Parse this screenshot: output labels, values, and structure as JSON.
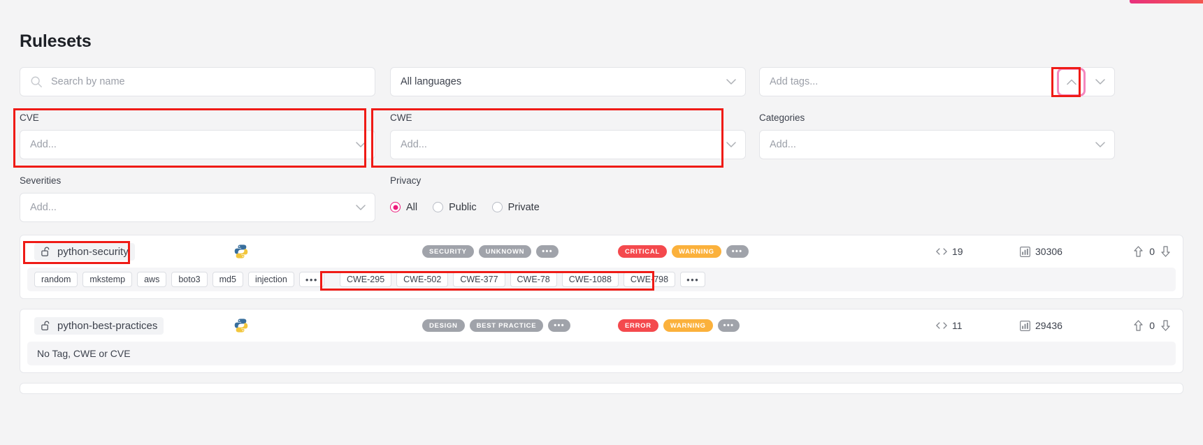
{
  "page": {
    "title": "Rulesets"
  },
  "filters": {
    "search": {
      "name": "Search by name",
      "placeholder": "Search by name",
      "value": ""
    },
    "language": {
      "label": "",
      "value": "All languages"
    },
    "tags": {
      "label": "",
      "placeholder": "Add tags..."
    },
    "cve": {
      "label": "CVE",
      "placeholder": "Add..."
    },
    "cwe": {
      "label": "CWE",
      "placeholder": "Add..."
    },
    "categories": {
      "label": "Categories",
      "placeholder": "Add..."
    },
    "severities": {
      "label": "Severities",
      "placeholder": "Add..."
    },
    "privacy": {
      "label": "Privacy",
      "options": [
        {
          "label": "All",
          "selected": true
        },
        {
          "label": "Public",
          "selected": false
        },
        {
          "label": "Private",
          "selected": false
        }
      ]
    },
    "collapse_button": {
      "icon": "chevron-up-icon"
    }
  },
  "colors": {
    "accent_pink": "#ec1a7c",
    "annotation_red": "#ef1b16",
    "highlight_pink": "#f487bd",
    "critical": "#f4494d",
    "warning": "#fbb13c",
    "grey_badge": "#a0a3aa"
  },
  "rulesets": [
    {
      "name": "python-security",
      "lock_icon": "unlock-icon",
      "language": "python",
      "categories": [
        "SECURITY",
        "UNKNOWN"
      ],
      "categories_more": "•••",
      "severities": [
        "CRITICAL",
        "WARNING"
      ],
      "severities_more": "•••",
      "rules_count": "19",
      "lines_count": "30306",
      "votes": "0",
      "tags": [
        "random",
        "mkstemp",
        "aws",
        "boto3",
        "md5",
        "injection"
      ],
      "tags_more": "•••",
      "cwes": [
        "CWE-295",
        "CWE-502",
        "CWE-377",
        "CWE-78",
        "CWE-1088",
        "CWE-798"
      ],
      "cwes_more": "•••"
    },
    {
      "name": "python-best-practices",
      "lock_icon": "unlock-icon",
      "language": "python",
      "categories": [
        "DESIGN",
        "BEST PRACTICE"
      ],
      "categories_more": "•••",
      "severities": [
        "ERROR",
        "WARNING"
      ],
      "severities_more": "•••",
      "rules_count": "11",
      "lines_count": "29436",
      "votes": "0",
      "empty_text": "No Tag, CWE or CVE"
    }
  ]
}
